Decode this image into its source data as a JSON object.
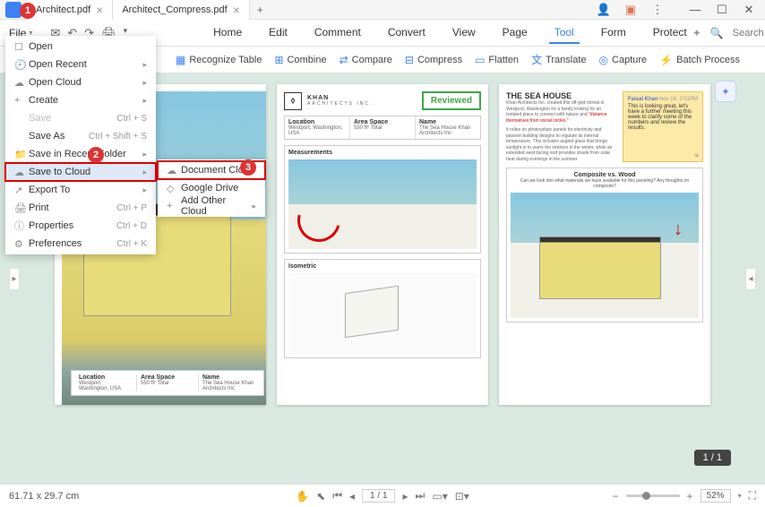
{
  "tabs": [
    {
      "label": "Architect.pdf",
      "active": false
    },
    {
      "label": "Architect_Compress.pdf",
      "active": true
    }
  ],
  "menubar": {
    "file": "File",
    "items": [
      "Home",
      "Edit",
      "Comment",
      "Convert",
      "View",
      "Page",
      "Tool",
      "Form",
      "Protect"
    ],
    "active": "Tool",
    "search_placeholder": "Search Tools"
  },
  "toolbar": [
    "Recognize Table",
    "Combine",
    "Compare",
    "Compress",
    "Flatten",
    "Translate",
    "Capture",
    "Batch Process"
  ],
  "dropdown": [
    {
      "icon": "☐",
      "label": "Open",
      "shortcut": "",
      "arrow": false,
      "state": ""
    },
    {
      "icon": "🕘",
      "label": "Open Recent",
      "shortcut": "",
      "arrow": true,
      "state": ""
    },
    {
      "icon": "☁",
      "label": "Open Cloud",
      "shortcut": "",
      "arrow": true,
      "state": ""
    },
    {
      "icon": "+",
      "label": "Create",
      "shortcut": "",
      "arrow": true,
      "state": ""
    },
    {
      "icon": "",
      "label": "Save",
      "shortcut": "Ctrl + S",
      "arrow": false,
      "state": "disabled"
    },
    {
      "icon": "",
      "label": "Save As",
      "shortcut": "Ctrl + Shift + S",
      "arrow": false,
      "state": ""
    },
    {
      "icon": "📁",
      "label": "Save in Recent Folder",
      "shortcut": "",
      "arrow": true,
      "state": ""
    },
    {
      "icon": "☁",
      "label": "Save to Cloud",
      "shortcut": "",
      "arrow": true,
      "state": "highlighted boxed"
    },
    {
      "icon": "↗",
      "label": "Export To",
      "shortcut": "",
      "arrow": true,
      "state": ""
    },
    {
      "icon": "🖨",
      "label": "Print",
      "shortcut": "Ctrl + P",
      "arrow": false,
      "state": ""
    },
    {
      "icon": "ⓘ",
      "label": "Properties",
      "shortcut": "Ctrl + D",
      "arrow": false,
      "state": ""
    },
    {
      "icon": "⚙",
      "label": "Preferences",
      "shortcut": "Ctrl + K",
      "arrow": false,
      "state": ""
    }
  ],
  "submenu": [
    {
      "icon": "☁",
      "label": "Document Cloud",
      "arrow": false,
      "state": "boxed"
    },
    {
      "icon": "◇",
      "label": "Google Drive",
      "arrow": false,
      "state": ""
    },
    {
      "icon": "+",
      "label": "Add Other Cloud",
      "arrow": true,
      "state": ""
    }
  ],
  "page1": {
    "title": "EA HOUSE",
    "info": [
      {
        "label": "Location",
        "val": "Westport, Washington, USA"
      },
      {
        "label": "Area Space",
        "val": "550 ft² Total"
      },
      {
        "label": "Name",
        "val": "The Sea House Khan Architects Inc"
      }
    ]
  },
  "page2": {
    "brand": "KHAN",
    "brand_sub": "ARCHITECTS INC.",
    "badge": "Reviewed",
    "info": [
      {
        "label": "Location",
        "val": "Westport, Washington, USA"
      },
      {
        "label": "Area Space",
        "val": "550 ft² Total"
      },
      {
        "label": "Name",
        "val": "The Sea House Khan Architects Inc"
      }
    ],
    "panel1": "Measurements",
    "panel2": "Isometric"
  },
  "page3": {
    "title": "THE SEA HOUSE",
    "desc1": "Khan Architects Inc. created this off-grid retreat in Westport, Washington for a family looking for an isolated place to connect with nature and",
    "desc_red": "\"distance themselves from social circles.\"",
    "desc2": "It relies on photovoltaic panels for electricity and passive building designs to regulate its internal temperature. This includes angled glass that brings sunlight in to warm the interiors in the winter, while an extended west-facing roof provides shade from solar heat during evenings in the summer.",
    "note_name": "Faisal Khan",
    "note_date": "Nov 16, 2:01PM",
    "note_text": "This is looking great, let's have a further meeting this week to clarify some of the numbers and review the results.",
    "comp_title": "Composite vs. Wood",
    "comp_sub": "Can we look into what materials we have available for this paneling? Any thoughts on composite?"
  },
  "page_indicator": "1 / 1",
  "status": {
    "dims": "61.71 x 29.7 cm",
    "page": "1 / 1",
    "zoom": "52%"
  },
  "badges": {
    "b1": "1",
    "b2": "2",
    "b3": "3"
  }
}
